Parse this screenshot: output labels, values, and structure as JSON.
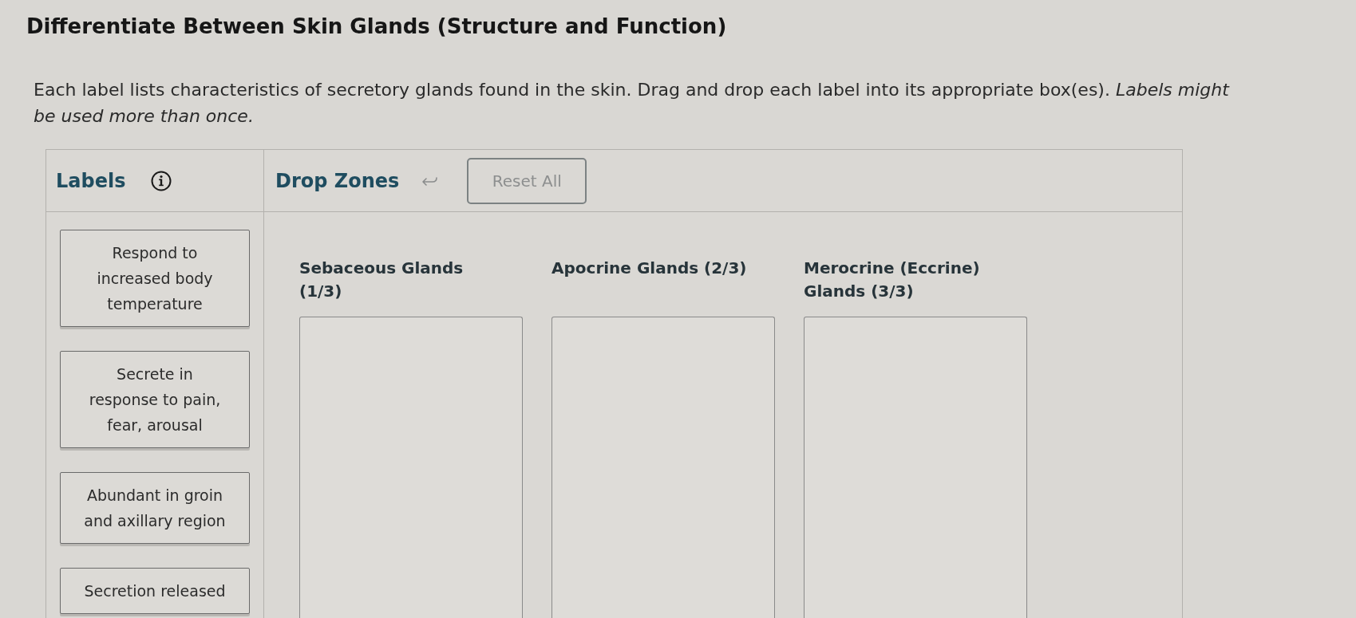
{
  "title": "Differentiate Between Skin Glands (Structure and Function)",
  "instructions": "Each label lists characteristics of secretory glands found in the skin. Drag and drop each label into its appropriate box(es). *Labels might be used more than once.*",
  "panel": {
    "labels_heading": "Labels",
    "drop_zones_heading": "Drop Zones",
    "reset_button": {
      "label": "Reset All",
      "disabled": true
    }
  },
  "labels": [
    {
      "text": "Respond to\nincreased body\ntemperature"
    },
    {
      "text": "Secrete in\nresponse to pain,\nfear, arousal"
    },
    {
      "text": "Abundant in groin\nand axillary region"
    },
    {
      "text": "Secretion released"
    }
  ],
  "drop_zones": [
    {
      "heading": "Sebaceous Glands\n(1/3)"
    },
    {
      "heading": "Apocrine Glands (2/3)"
    },
    {
      "heading": "Merocrine (Eccrine)\nGlands (3/3)"
    }
  ]
}
